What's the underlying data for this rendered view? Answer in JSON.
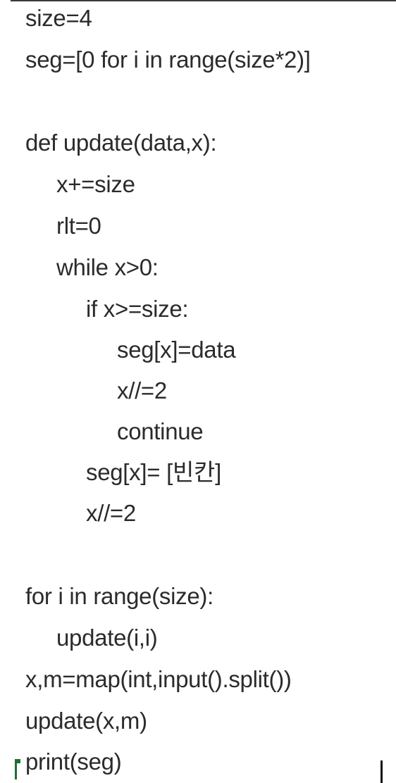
{
  "code": {
    "lines": [
      "size=4",
      "seg=[0 for i in range(size*2)]",
      "def update(data,x):",
      "x+=size",
      "rlt=0",
      "while x>0:",
      "if x>=size:",
      "seg[x]=data",
      "x//=2",
      "continue",
      "seg[x]= [빈칸]",
      "x//=2",
      "for i in range(size):",
      "update(i,i)",
      "x,m=map(int,input().split())",
      "update(x,m)",
      "print(seg)"
    ]
  },
  "colors": {
    "text": "#2b2b2b",
    "background": "#ffffff",
    "left_cursor": "#1f6e35",
    "right_cursor": "#111111"
  }
}
